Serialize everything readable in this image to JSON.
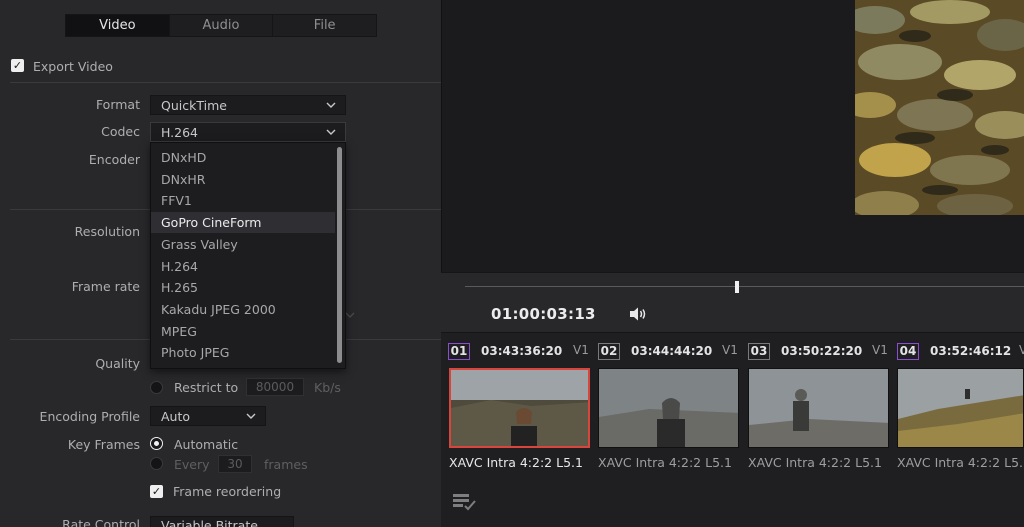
{
  "tabs": [
    "Video",
    "Audio",
    "File"
  ],
  "export_video": {
    "label": "Export Video",
    "checked": true
  },
  "format": {
    "label": "Format",
    "value": "QuickTime"
  },
  "codec": {
    "label": "Codec",
    "value": "H.264"
  },
  "encoder": {
    "label": "Encoder"
  },
  "resolution": {
    "label": "Resolution"
  },
  "frame_rate": {
    "label": "Frame rate"
  },
  "quality": {
    "label": "Quality",
    "restrict_label": "Restrict to",
    "restrict_value": "80000",
    "restrict_unit": "Kb/s"
  },
  "encoding_profile": {
    "label": "Encoding Profile",
    "value": "Auto"
  },
  "key_frames": {
    "label": "Key Frames",
    "automatic": "Automatic",
    "every": "Every",
    "every_value": "30",
    "every_unit": "frames",
    "frame_reordering": "Frame reordering"
  },
  "rate_control": {
    "label": "Rate Control",
    "value": "Variable Bitrate"
  },
  "codec_dropdown": {
    "items": [
      "DNxHD",
      "DNxHR",
      "FFV1",
      "GoPro CineForm",
      "Grass Valley",
      "H.264",
      "H.265",
      "Kakadu JPEG 2000",
      "MPEG",
      "Photo JPEG"
    ],
    "highlighted": "GoPro CineForm"
  },
  "viewer": {
    "timecode": "01:00:03:13"
  },
  "clips": [
    {
      "num": "01",
      "tc": "03:43:36:20",
      "track": "V1",
      "name": "XAVC Intra 4:2:2 L5.1",
      "color": "#8a4fd0",
      "selected": true
    },
    {
      "num": "02",
      "tc": "03:44:44:20",
      "track": "V1",
      "name": "XAVC Intra 4:2:2 L5.1",
      "color": "#7a7a7d",
      "selected": false
    },
    {
      "num": "03",
      "tc": "03:50:22:20",
      "track": "V1",
      "name": "XAVC Intra 4:2:2 L5.1",
      "color": "#7a7a7d",
      "selected": false
    },
    {
      "num": "04",
      "tc": "03:52:46:12",
      "track": "V",
      "name": "XAVC Intra 4:2:2 L5.1",
      "color": "#8a4fd0",
      "selected": false
    }
  ]
}
